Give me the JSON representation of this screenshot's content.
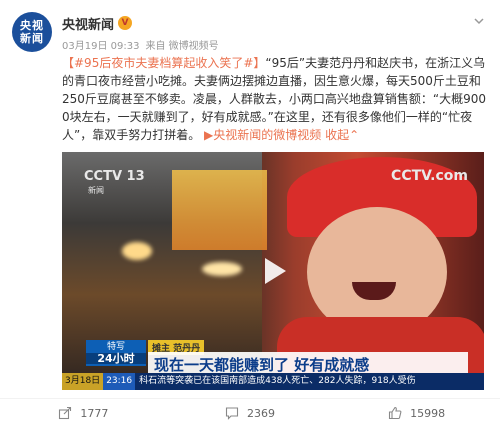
{
  "post": {
    "author": "央视新闻",
    "avatar_text": "央视新闻",
    "vip_badge": "V",
    "date": "03月19日 09:33",
    "source": "来自 微博视频号",
    "hashtag": "【#95后夜市夫妻档算起收入笑了#】",
    "body": "“95后”夫妻范丹丹和赵庆书，在浙江义乌的青口夜市经营小吃摊。夫妻俩边摆摊边直播，因生意火爆，每天500斤土豆和250斤豆腐甚至不够卖。凌晨，人群散去，小两口高兴地盘算销售额：“大概9000块左右，一天就赚到了，好有成就感。”在这里，还有很多像他们一样的“忙夜人”，靠双手努力打拼着。",
    "video_link": "央视新闻的微博视频",
    "collapse_label": "收起",
    "collapse_arrow": "⌃"
  },
  "video": {
    "channel_logo": "CCTV 13",
    "channel_sub": "新闻",
    "watermark": "CCTV.com",
    "program_tag_top": "特写",
    "program_tag_bottom": "24小时",
    "speaker_label": "摊主 范丹丹",
    "subtitle": "现在一天都能赚到了 好有成就感",
    "ticker_date": "3月18日",
    "ticker_time": "23:16",
    "ticker_text": "科石流等突袭已在该国南部造成438人死亡、282人失踪，918人受伤"
  },
  "footer": {
    "share_count": "1777",
    "comment_count": "2369",
    "like_count": "15998"
  },
  "colors": {
    "link": "#eb7350",
    "avatar_bg": "#1b4f9b",
    "subtitle_text": "#0c3d8a"
  },
  "icons": {
    "more": "chevron-down-icon",
    "play": "play-icon",
    "share": "share-icon",
    "comment": "comment-icon",
    "like": "like-icon"
  }
}
